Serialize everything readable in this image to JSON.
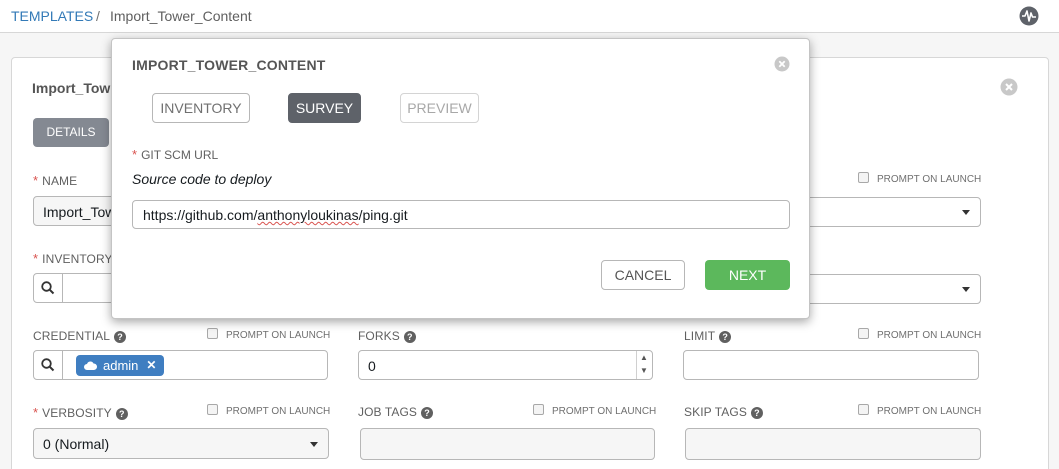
{
  "breadcrumb": {
    "templates": "TEMPLATES",
    "separator": "/",
    "current": "Import_Tower_Content"
  },
  "panel": {
    "title": "Import_Tow",
    "tab_details": "DETAILS"
  },
  "form": {
    "name_label": "NAME",
    "name_value": "Import_Tow",
    "inventory_label": "INVENTORY",
    "prompt_label": "PROMPT ON LAUNCH",
    "credential_label": "CREDENTIAL",
    "credential_chip": "admin",
    "forks_label": "FORKS",
    "forks_value": "0",
    "limit_label": "LIMIT",
    "verbosity_label": "VERBOSITY",
    "verbosity_value": "0 (Normal)",
    "job_tags_label": "JOB TAGS",
    "skip_tags_label": "SKIP TAGS"
  },
  "modal": {
    "title": "IMPORT_TOWER_CONTENT",
    "tabs": [
      {
        "label": "INVENTORY"
      },
      {
        "label": "SURVEY"
      },
      {
        "label": "PREVIEW"
      }
    ],
    "question_label": "GIT SCM URL",
    "question_desc": "Source code to deploy",
    "url_prefix": "https://github.com/",
    "url_misspelled": "anthonyloukinas",
    "url_suffix": "/ping.git",
    "cancel_label": "CANCEL",
    "next_label": "NEXT"
  },
  "colors": {
    "link": "#337ab7",
    "required": "#d9534f",
    "next_button": "#5cb85c",
    "survey_tab": "#5e6269",
    "chip": "#3f7ec1"
  },
  "icons": [
    "activity-icon",
    "close-icon",
    "search-icon",
    "cloud-icon",
    "help-icon",
    "caret-down-icon"
  ]
}
